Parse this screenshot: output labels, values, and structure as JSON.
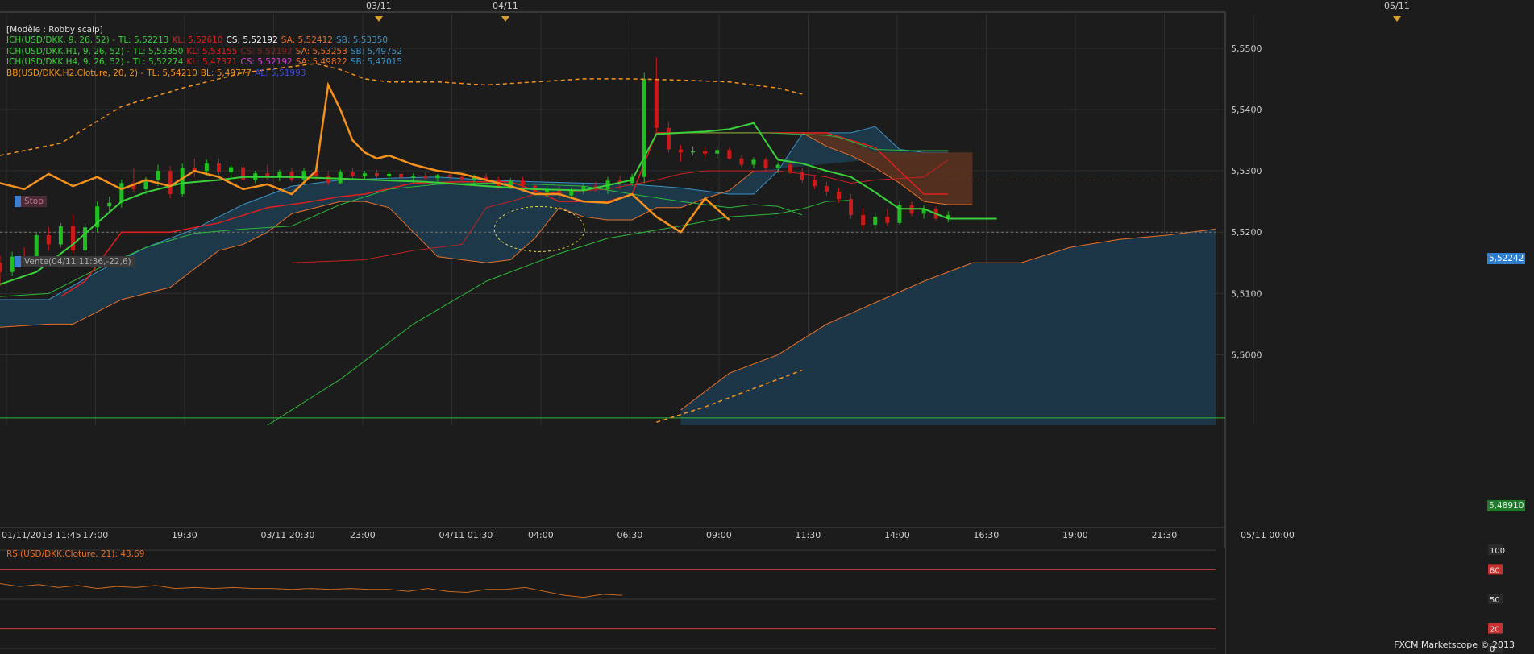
{
  "colors": {
    "background": "#1c1c1c",
    "grid": "#2e2e2e",
    "axis_text": "#cfcfcf",
    "cloud_fill": "#1e3a4c",
    "cloud_edge": "#3b93c6",
    "cloud_red_fill": "#5a3220",
    "tenkan": "#3ad13a",
    "kijun": "#e02020",
    "bollinger": "#f5921e",
    "candle_up": "#1fbf1f",
    "candle_down": "#cc1a1a",
    "rsi_line": "#c8681e",
    "rsi_level": "#d33a3a"
  },
  "legend": {
    "model": "[Modèle : Robby scalp]",
    "lines": [
      {
        "text": "ICH(USD/DKK, 9, 26, 52) -",
        "tl": "TL: 5,52213",
        "kl": "KL: 5,52610",
        "cs": "CS: 5,52192",
        "sa": "SA: 5,52412",
        "sb": "SB: 5,53350",
        "cs_color": "#f5f5f5"
      },
      {
        "text": "ICH(USD/DKK.H1, 9, 26, 52) -",
        "tl": "TL: 5,53350",
        "kl": "KL: 5,53155",
        "cs": "CS: 5,52192",
        "sa": "SA: 5,53253",
        "sb": "SB: 5,49752",
        "cs_color": "#7a2a1c"
      },
      {
        "text": "ICH(USD/DKK.H4, 9, 26, 52) -",
        "tl": "TL: 5,52274",
        "kl": "KL: 5,47371",
        "cs": "CS: 5,52192",
        "sa": "SA: 5,49822",
        "sb": "SB: 5,47015",
        "cs_color": "#d040d0"
      }
    ],
    "bb": {
      "text": "BB(USD/DKK.H2.Cloture, 20, 2) -",
      "tl": "TL: 5,54210",
      "bl": "BL: 5,49777",
      "al": "AL: 5,51993"
    }
  },
  "tags": {
    "stop": "Stop",
    "sell": "Vente(04/11 11:36,-22,6)"
  },
  "top_dates": [
    "03/11",
    "04/11",
    "05/11"
  ],
  "price_tags": {
    "current": "5,52242",
    "low": "5,48910"
  },
  "rsi": {
    "label": "RSI(USD/DKK.Cloture, 21): 43,69",
    "levels": [
      "100",
      "80",
      "50",
      "20",
      "0"
    ]
  },
  "copyright": "FXCM Marketscope © 2013",
  "chart_data": {
    "type": "line",
    "title": "",
    "x_tick_labels": [
      "01/11/2013 11:45",
      "17:00",
      "19:30",
      "03/11 20:30",
      "23:00",
      "04/11 01:30",
      "04:00",
      "06:30",
      "09:00",
      "11:30",
      "14:00",
      "16:30",
      "19:00",
      "21:30",
      "05/11 00:00"
    ],
    "y_tick_labels": [
      "5,5500",
      "5,5400",
      "5,5300",
      "5,5200",
      "5,5100",
      "5,5000"
    ],
    "ylim": [
      5.4885,
      5.5555
    ],
    "x_range": [
      0,
      100
    ],
    "grid": true,
    "candles": [
      [
        0,
        5.515,
        5.5162,
        5.5112,
        5.5135
      ],
      [
        1,
        5.5135,
        5.5168,
        5.5128,
        5.516
      ],
      [
        2,
        5.516,
        5.5175,
        5.5145,
        5.5152
      ],
      [
        3,
        5.5152,
        5.52,
        5.515,
        5.5195
      ],
      [
        4,
        5.5195,
        5.5208,
        5.517,
        5.518
      ],
      [
        5,
        5.518,
        5.5215,
        5.5175,
        5.521
      ],
      [
        6,
        5.521,
        5.5228,
        5.5165,
        5.517
      ],
      [
        7,
        5.517,
        5.5215,
        5.5165,
        5.5208
      ],
      [
        8,
        5.5208,
        5.525,
        5.52,
        5.5242
      ],
      [
        9,
        5.5242,
        5.5258,
        5.523,
        5.5248
      ],
      [
        10,
        5.5248,
        5.5285,
        5.524,
        5.528
      ],
      [
        11,
        5.528,
        5.5305,
        5.5265,
        5.527
      ],
      [
        12,
        5.527,
        5.529,
        5.5262,
        5.5285
      ],
      [
        13,
        5.5285,
        5.531,
        5.5275,
        5.53
      ],
      [
        14,
        5.53,
        5.5308,
        5.5255,
        5.5262
      ],
      [
        15,
        5.5262,
        5.5312,
        5.5258,
        5.5305
      ],
      [
        16,
        5.5305,
        5.532,
        5.529,
        5.53
      ],
      [
        17,
        5.53,
        5.5318,
        5.5292,
        5.5312
      ],
      [
        18,
        5.5312,
        5.532,
        5.529,
        5.5298
      ],
      [
        19,
        5.5298,
        5.531,
        5.5285,
        5.5306
      ],
      [
        20,
        5.5306,
        5.5312,
        5.528,
        5.5285
      ],
      [
        21,
        5.5285,
        5.53,
        5.528,
        5.5296
      ],
      [
        22,
        5.5296,
        5.531,
        5.5285,
        5.529
      ],
      [
        23,
        5.529,
        5.5302,
        5.5283,
        5.5298
      ],
      [
        24,
        5.5298,
        5.5305,
        5.5282,
        5.5286
      ],
      [
        25,
        5.5286,
        5.5305,
        5.528,
        5.53
      ],
      [
        26,
        5.53,
        5.5306,
        5.5285,
        5.5292
      ],
      [
        27,
        5.5292,
        5.53,
        5.5276,
        5.528
      ],
      [
        28,
        5.528,
        5.5302,
        5.5278,
        5.5298
      ],
      [
        29,
        5.5298,
        5.5305,
        5.5288,
        5.5292
      ],
      [
        30,
        5.5292,
        5.53,
        5.5285,
        5.5296
      ],
      [
        31,
        5.5296,
        5.5302,
        5.5288,
        5.5291
      ],
      [
        32,
        5.5291,
        5.5299,
        5.5286,
        5.5295
      ],
      [
        33,
        5.5295,
        5.53,
        5.5286,
        5.5289
      ],
      [
        34,
        5.5289,
        5.5296,
        5.528,
        5.5292
      ],
      [
        35,
        5.5292,
        5.5298,
        5.5285,
        5.5288
      ],
      [
        36,
        5.5288,
        5.5295,
        5.528,
        5.5293
      ],
      [
        37,
        5.5293,
        5.53,
        5.5285,
        5.529
      ],
      [
        38,
        5.529,
        5.5297,
        5.5282,
        5.5286
      ],
      [
        39,
        5.5286,
        5.5294,
        5.5278,
        5.529
      ],
      [
        40,
        5.529,
        5.5296,
        5.5281,
        5.5285
      ],
      [
        41,
        5.5285,
        5.529,
        5.527,
        5.5273
      ],
      [
        42,
        5.5273,
        5.5288,
        5.527,
        5.5284
      ],
      [
        43,
        5.5284,
        5.529,
        5.5272,
        5.5276
      ],
      [
        44,
        5.5276,
        5.5282,
        5.526,
        5.5265
      ],
      [
        45,
        5.5265,
        5.5275,
        5.5258,
        5.527
      ],
      [
        46,
        5.527,
        5.5276,
        5.5255,
        5.526
      ],
      [
        47,
        5.526,
        5.5272,
        5.5255,
        5.5268
      ],
      [
        48,
        5.5268,
        5.528,
        5.5262,
        5.5275
      ],
      [
        49,
        5.5275,
        5.5282,
        5.5265,
        5.527
      ],
      [
        50,
        5.527,
        5.529,
        5.5262,
        5.5284
      ],
      [
        51,
        5.5284,
        5.5292,
        5.527,
        5.528
      ],
      [
        52,
        5.528,
        5.5295,
        5.5275,
        5.529
      ],
      [
        53,
        5.529,
        5.546,
        5.528,
        5.545
      ],
      [
        54,
        5.545,
        5.5485,
        5.536,
        5.537
      ],
      [
        55,
        5.537,
        5.538,
        5.533,
        5.5335
      ],
      [
        56,
        5.5335,
        5.5342,
        5.5315,
        5.533
      ],
      [
        57,
        5.533,
        5.534,
        5.5325,
        5.5332
      ],
      [
        58,
        5.5332,
        5.5338,
        5.5322,
        5.5328
      ],
      [
        59,
        5.5328,
        5.5338,
        5.532,
        5.5334
      ],
      [
        60,
        5.5334,
        5.5338,
        5.5318,
        5.532
      ],
      [
        61,
        5.532,
        5.5326,
        5.5306,
        5.531
      ],
      [
        62,
        5.531,
        5.5322,
        5.5305,
        5.5318
      ],
      [
        63,
        5.5318,
        5.5322,
        5.53,
        5.5305
      ],
      [
        64,
        5.5305,
        5.5314,
        5.5296,
        5.531
      ],
      [
        65,
        5.531,
        5.5316,
        5.5295,
        5.5298
      ],
      [
        66,
        5.5298,
        5.5305,
        5.528,
        5.5285
      ],
      [
        67,
        5.5285,
        5.5292,
        5.527,
        5.5275
      ],
      [
        68,
        5.5275,
        5.5282,
        5.526,
        5.5266
      ],
      [
        69,
        5.5266,
        5.5272,
        5.5248,
        5.5254
      ],
      [
        70,
        5.5254,
        5.5262,
        5.5222,
        5.5228
      ],
      [
        71,
        5.5228,
        5.524,
        5.5205,
        5.5212
      ],
      [
        72,
        5.5212,
        5.523,
        5.5205,
        5.5225
      ],
      [
        73,
        5.5225,
        5.5238,
        5.521,
        5.5215
      ],
      [
        74,
        5.5215,
        5.525,
        5.5212,
        5.5244
      ],
      [
        75,
        5.5244,
        5.525,
        5.5226,
        5.523
      ],
      [
        76,
        5.523,
        5.5245,
        5.5222,
        5.5238
      ],
      [
        77,
        5.5238,
        5.5242,
        5.5218,
        5.5222
      ],
      [
        78,
        5.5222,
        5.5234,
        5.5216,
        5.5228
      ]
    ],
    "series": [
      {
        "role": "tenkan",
        "x": [
          0,
          3,
          6,
          8,
          10,
          12,
          15,
          18,
          20,
          24,
          27,
          31,
          35,
          40,
          44,
          48,
          52,
          54,
          56,
          58,
          60,
          62,
          64,
          66,
          68,
          70,
          72,
          74,
          76,
          78,
          80,
          82
        ],
        "y": [
          5.5115,
          5.5135,
          5.518,
          5.5215,
          5.525,
          5.5265,
          5.528,
          5.5285,
          5.529,
          5.529,
          5.5288,
          5.5285,
          5.5282,
          5.5275,
          5.527,
          5.5268,
          5.5285,
          5.536,
          5.5362,
          5.5364,
          5.5368,
          5.5378,
          5.5318,
          5.5312,
          5.53,
          5.529,
          5.5265,
          5.5238,
          5.5238,
          5.5222,
          5.5222,
          5.5222
        ]
      },
      {
        "role": "tenkan_flat",
        "x": [
          55,
          63,
          68,
          69,
          72,
          75,
          78
        ],
        "y": [
          5.5362,
          5.5362,
          5.5358,
          5.5355,
          5.5335,
          5.5333,
          5.5333
        ]
      },
      {
        "role": "tenkan_long",
        "x": [
          0,
          4,
          8,
          12,
          16,
          20,
          24,
          28,
          32,
          36,
          40,
          44,
          48,
          52,
          56,
          60,
          62,
          64,
          66
        ],
        "y": [
          5.5095,
          5.51,
          5.514,
          5.5175,
          5.5198,
          5.5205,
          5.521,
          5.5245,
          5.527,
          5.5278,
          5.528,
          5.5278,
          5.5275,
          5.5262,
          5.525,
          5.524,
          5.5245,
          5.5242,
          5.5228
        ]
      },
      {
        "role": "kijun",
        "x": [
          5,
          7,
          10,
          14,
          18,
          22,
          25,
          28,
          30,
          34,
          38,
          42,
          44,
          46,
          50,
          52,
          54,
          56,
          60,
          64,
          68,
          70,
          72,
          74,
          76,
          78
        ],
        "y": [
          5.5095,
          5.512,
          5.52,
          5.52,
          5.5215,
          5.524,
          5.5248,
          5.5258,
          5.5262,
          5.528,
          5.5282,
          5.5282,
          5.5268,
          5.525,
          5.525,
          5.5262,
          5.5362,
          5.5362,
          5.5362,
          5.5362,
          5.5362,
          5.535,
          5.5338,
          5.53,
          5.5262,
          5.5262
        ]
      },
      {
        "role": "kijun2",
        "x": [
          24,
          30,
          34,
          38,
          40,
          42,
          44,
          50,
          54,
          56,
          58,
          60,
          64,
          66,
          68,
          70,
          72,
          76,
          78
        ],
        "y": [
          5.515,
          5.5155,
          5.517,
          5.518,
          5.524,
          5.525,
          5.5262,
          5.527,
          5.5285,
          5.5295,
          5.53,
          5.53,
          5.53,
          5.5295,
          5.529,
          5.528,
          5.5285,
          5.529,
          5.5318
        ]
      },
      {
        "role": "green_diag",
        "x": [
          22,
          28,
          34,
          40,
          44,
          46,
          50,
          56,
          60,
          64,
          66,
          68,
          70
        ],
        "y": [
          5.4885,
          5.496,
          5.505,
          5.512,
          5.515,
          5.5165,
          5.519,
          5.521,
          5.5225,
          5.523,
          5.5238,
          5.525,
          5.5252
        ]
      },
      {
        "role": "bollinger_close",
        "x": [
          0,
          2,
          4,
          6,
          8,
          10,
          12,
          14,
          16,
          18,
          20,
          22,
          24,
          26,
          27,
          28,
          29,
          30,
          31,
          32,
          34,
          36,
          38,
          40,
          42,
          44,
          46,
          48,
          50,
          52,
          54,
          56,
          58,
          60
        ],
        "y": [
          5.528,
          5.527,
          5.5295,
          5.5275,
          5.529,
          5.527,
          5.5285,
          5.5275,
          5.53,
          5.529,
          5.527,
          5.5278,
          5.5262,
          5.53,
          5.544,
          5.54,
          5.535,
          5.533,
          5.532,
          5.5325,
          5.531,
          5.53,
          5.5295,
          5.5285,
          5.5275,
          5.5262,
          5.5262,
          5.525,
          5.5248,
          5.5262,
          5.5225,
          5.52,
          5.5255,
          5.522
        ]
      },
      {
        "role": "bollinger_upper",
        "x": [
          0,
          5,
          10,
          15,
          20,
          24,
          26,
          28,
          30,
          32,
          36,
          40,
          44,
          48,
          52,
          56,
          60,
          64,
          66
        ],
        "y": [
          5.5325,
          5.5345,
          5.5405,
          5.5435,
          5.546,
          5.547,
          5.5475,
          5.5465,
          5.545,
          5.5445,
          5.5445,
          5.544,
          5.5445,
          5.545,
          5.545,
          5.5448,
          5.5445,
          5.5435,
          5.5425
        ]
      },
      {
        "role": "bollinger_lower",
        "x": [
          54,
          58,
          62,
          64,
          66
        ],
        "y": [
          5.489,
          5.4915,
          5.4945,
          5.496,
          5.4975
        ]
      },
      {
        "role": "cloud_upper",
        "x": [
          0,
          4,
          8,
          12,
          16,
          20,
          24,
          28,
          32,
          36,
          40,
          44,
          48,
          52,
          56,
          60,
          62,
          64,
          66,
          68,
          70,
          72,
          74,
          76,
          78
        ],
        "y": [
          5.509,
          5.509,
          5.5135,
          5.5175,
          5.5205,
          5.5245,
          5.5275,
          5.5285,
          5.5288,
          5.529,
          5.5285,
          5.5282,
          5.528,
          5.5278,
          5.5272,
          5.5262,
          5.5262,
          5.53,
          5.536,
          5.5362,
          5.5362,
          5.5372,
          5.5335,
          5.533,
          5.533
        ]
      },
      {
        "role": "cloud_lower",
        "x": [
          0,
          4,
          6,
          8,
          10,
          12,
          14,
          16,
          18,
          20,
          22,
          24,
          26,
          28,
          30,
          32,
          34,
          36,
          38,
          40,
          42,
          44,
          46,
          48,
          50,
          52,
          54,
          56,
          58,
          60,
          62
        ],
        "y": [
          5.5045,
          5.505,
          5.505,
          5.507,
          5.509,
          5.51,
          5.511,
          5.514,
          5.517,
          5.518,
          5.52,
          5.523,
          5.524,
          5.525,
          5.525,
          5.524,
          5.52,
          5.516,
          5.5155,
          5.515,
          5.5155,
          5.519,
          5.524,
          5.5225,
          5.522,
          5.522,
          5.524,
          5.524,
          5.5255,
          5.5268,
          5.53
        ]
      },
      {
        "role": "cloud_h4_upper",
        "x": [
          56,
          60,
          64,
          68,
          72,
          76,
          80,
          84,
          88,
          92,
          96,
          100
        ],
        "y": [
          5.491,
          5.497,
          5.5,
          5.505,
          5.5085,
          5.512,
          5.515,
          5.515,
          5.5175,
          5.5188,
          5.5195,
          5.5205
        ]
      },
      {
        "role": "cloud_red_upper",
        "x": [
          66,
          68,
          70,
          72,
          74,
          76,
          78,
          80
        ],
        "y": [
          5.5362,
          5.5362,
          5.535,
          5.533,
          5.533,
          5.533,
          5.533,
          5.533
        ]
      },
      {
        "role": "cloud_red_lower",
        "x": [
          66,
          68,
          70,
          72,
          74,
          76,
          78,
          80
        ],
        "y": [
          5.5362,
          5.534,
          5.5325,
          5.5305,
          5.528,
          5.525,
          5.5245,
          5.5245
        ]
      },
      {
        "role": "rsi",
        "x": [
          0,
          2,
          4,
          6,
          8,
          10,
          12,
          14,
          16,
          18,
          20,
          22,
          24,
          26,
          28,
          30,
          32,
          34,
          36,
          38,
          40,
          42,
          44,
          46,
          48,
          50,
          52,
          54,
          56,
          58,
          60,
          62,
          64
        ],
        "y": [
          66,
          63,
          65,
          62,
          64,
          61,
          63,
          62,
          64,
          61,
          62,
          61,
          62,
          61,
          61,
          60,
          61,
          60,
          61,
          60,
          60,
          58,
          61,
          58,
          57,
          60,
          60,
          62,
          58,
          54,
          52,
          55,
          54
        ]
      }
    ]
  }
}
